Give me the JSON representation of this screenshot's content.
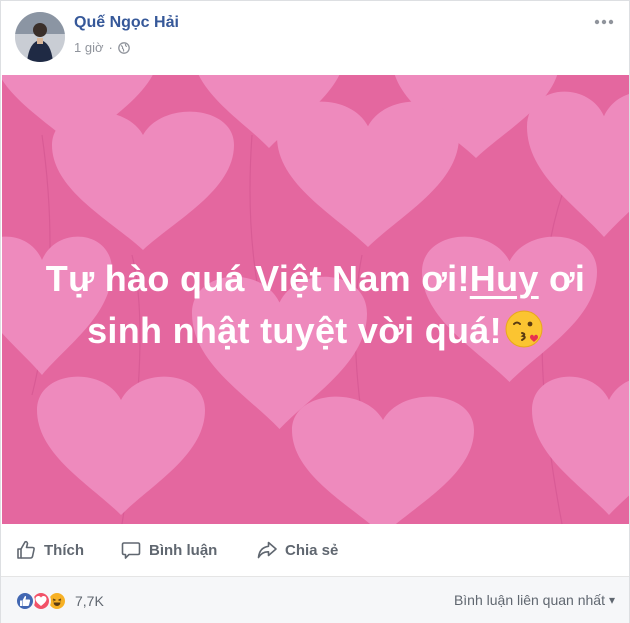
{
  "post": {
    "author": "Quế Ngọc Hải",
    "time": "1 giờ",
    "separator": "·",
    "privacy_icon": "globe-icon",
    "more_icon": "more-options-icon"
  },
  "banner": {
    "line1_text": "Tự hào quá Việt Nam ơi!",
    "line1_tag": "Huy",
    "line1_end": " ơi",
    "line2_text": "sinh nhật tuyệt vời quá!",
    "emoji": "kissing-face-emoji",
    "background_color": "#e4679f",
    "heart_color": "#ef8ec0"
  },
  "actions": {
    "like_label": "Thích",
    "comment_label": "Bình luận",
    "share_label": "Chia sẻ"
  },
  "footer": {
    "reactions": [
      "like",
      "love",
      "haha"
    ],
    "reaction_count": "7,7K",
    "sort_label": "Bình luận liên quan nhất",
    "sort_caret": "▾"
  },
  "colors": {
    "author": "#365899",
    "meta": "#90949c",
    "action": "#606770",
    "like_blue": "#4267b2",
    "love_red": "#f25268",
    "haha_yellow": "#f7b125"
  }
}
